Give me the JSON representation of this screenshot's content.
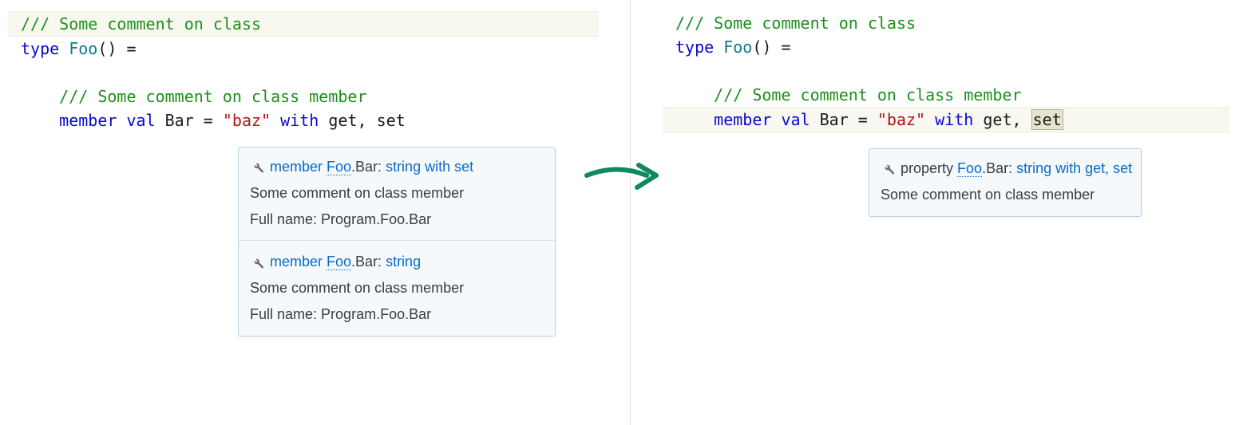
{
  "code": {
    "comment_class": "/// Some comment on class",
    "kw_type": "type",
    "type_name": "Foo",
    "parens_eq": "() =",
    "comment_member": "/// Some comment on class member",
    "indent": "    ",
    "kw_member": "member",
    "kw_val": "val",
    "ident_bar": "Bar",
    "eq": " = ",
    "str_baz": "\"baz\"",
    "kw_with": "with",
    "kw_get": "get",
    "comma": ", ",
    "kw_set": "set"
  },
  "tooltip_left": {
    "entries": [
      {
        "prefix": "member ",
        "foo": "Foo",
        "dot_bar": ".Bar: ",
        "type_label": "string",
        "suffix": " with set",
        "desc": "Some comment on class member",
        "full_label": "Full name: ",
        "full_value": "Program.Foo.Bar"
      },
      {
        "prefix": "member ",
        "foo": "Foo",
        "dot_bar": ".Bar: ",
        "type_label": "string",
        "suffix": "",
        "desc": "Some comment on class member",
        "full_label": "Full name: ",
        "full_value": "Program.Foo.Bar"
      }
    ]
  },
  "tooltip_right": {
    "prefix": "property ",
    "foo": "Foo",
    "dot_bar": ".Bar: ",
    "type_label": "string",
    "suffix": " with get, set",
    "desc": "Some comment on class member"
  }
}
